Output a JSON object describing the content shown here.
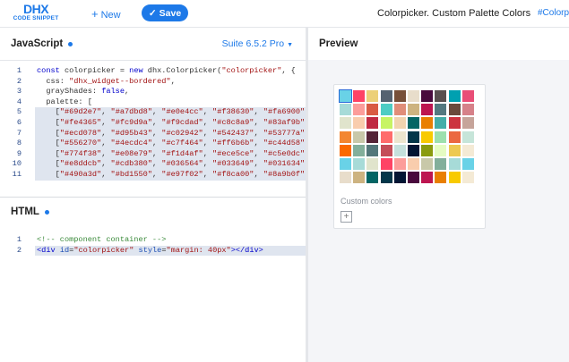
{
  "header": {
    "logo_main": "DHX",
    "logo_sub": "CODE SNIPPET",
    "new_label": "New",
    "save_label": "Save",
    "title": "Colorpicker. Custom Palette Colors",
    "tag": "#Colorp"
  },
  "js_panel": {
    "title": "JavaScript",
    "version": "Suite 6.5.2 Pro"
  },
  "html_panel": {
    "title": "HTML"
  },
  "preview_panel": {
    "title": "Preview",
    "custom_colors_label": "Custom colors"
  },
  "js_lines": [
    {
      "n": "1",
      "html": "<span class=\"kw\">const</span> colorpicker = <span class=\"kw\">new</span> dhx.Colorpicker(<span class=\"str\">\"colorpicker\"</span>, {"
    },
    {
      "n": "2",
      "html": "  css: <span class=\"str\">\"dhx_widget--bordered\"</span>,"
    },
    {
      "n": "3",
      "html": "  grayShades: <span class=\"kw\">false</span>,"
    },
    {
      "n": "4",
      "html": "  palette: ["
    },
    {
      "n": "5",
      "html": "    [<span class=\"str\">\"#69d2e7\"</span>, <span class=\"str\">\"#a7dbd8\"</span>, <span class=\"str\">\"#e0e4cc\"</span>, <span class=\"str\">\"#f38630\"</span>, <span class=\"str\">\"#fa6900\"</span>,"
    },
    {
      "n": "6",
      "html": "    [<span class=\"str\">\"#fe4365\"</span>, <span class=\"str\">\"#fc9d9a\"</span>, <span class=\"str\">\"#f9cdad\"</span>, <span class=\"str\">\"#c8c8a9\"</span>, <span class=\"str\">\"#83af9b\"</span>,"
    },
    {
      "n": "7",
      "html": "    [<span class=\"str\">\"#ecd078\"</span>, <span class=\"str\">\"#d95b43\"</span>, <span class=\"str\">\"#c02942\"</span>, <span class=\"str\">\"#542437\"</span>, <span class=\"str\">\"#53777a\"</span>,"
    },
    {
      "n": "8",
      "html": "    [<span class=\"str\">\"#556270\"</span>, <span class=\"str\">\"#4ecdc4\"</span>, <span class=\"str\">\"#c7f464\"</span>, <span class=\"str\">\"#ff6b6b\"</span>, <span class=\"str\">\"#c44d58\"</span>,"
    },
    {
      "n": "9",
      "html": "    [<span class=\"str\">\"#774f38\"</span>, <span class=\"str\">\"#e08e79\"</span>, <span class=\"str\">\"#f1d4af\"</span>, <span class=\"str\">\"#ece5ce\"</span>, <span class=\"str\">\"#c5e0dc\"</span>,"
    },
    {
      "n": "10",
      "html": "    [<span class=\"str\">\"#e8ddcb\"</span>, <span class=\"str\">\"#cdb380\"</span>, <span class=\"str\">\"#036564\"</span>, <span class=\"str\">\"#033649\"</span>, <span class=\"str\">\"#031634\"</span>,"
    },
    {
      "n": "11",
      "html": "    [<span class=\"str\">\"#490a3d\"</span>, <span class=\"str\">\"#bd1550\"</span>, <span class=\"str\">\"#e97f02\"</span>, <span class=\"str\">\"#f8ca00\"</span>, <span class=\"str\">\"#8a9b0f\"</span>,"
    }
  ],
  "html_lines": [
    {
      "n": "1",
      "html": "<span class=\"cm\">&lt;!-- component container --&gt;</span>"
    },
    {
      "n": "2",
      "html": "<span class=\"kw\">&lt;div</span> <span class=\"at\">id</span>=<span class=\"str\">\"colorpicker\"</span> <span class=\"at\">style</span>=<span class=\"str\">\"margin: 40px\"</span><span class=\"kw\">&gt;&lt;/div&gt;</span>"
    }
  ],
  "palette": [
    "#69d2e7",
    "#fe4365",
    "#ecd078",
    "#556270",
    "#774f38",
    "#e8ddcb",
    "#490a3d",
    "#594f4f",
    "#00a0b0",
    "#e94e77",
    "#a7dbd8",
    "#fc9d9a",
    "#d95b43",
    "#4ecdc4",
    "#e08e79",
    "#cdb380",
    "#bd1550",
    "#547980",
    "#6a4a3c",
    "#d68189",
    "#e0e4cc",
    "#f9cdad",
    "#c02942",
    "#c7f464",
    "#f1d4af",
    "#036564",
    "#e97f02",
    "#45ada8",
    "#cc333f",
    "#c6a49a",
    "#f38630",
    "#c8c8a9",
    "#542437",
    "#ff6b6b",
    "#ece5ce",
    "#033649",
    "#f8ca00",
    "#9de0ad",
    "#eb6841",
    "#c6e5d9",
    "#fa6900",
    "#83af9b",
    "#53777a",
    "#c44d58",
    "#c5e0dc",
    "#031634",
    "#8a9b0f",
    "#e5fcc2",
    "#edc951",
    "#f4ead5",
    "#69d2e7",
    "#a7dbd8",
    "#e0e4cc",
    "#fe4365",
    "#fc9d9a",
    "#f9cdad",
    "#c8c8a9",
    "#83af9b",
    "#a7dbd8",
    "#69d2e7",
    "#e8ddcb",
    "#cdb380",
    "#036564",
    "#033649",
    "#031634",
    "#490a3d",
    "#bd1550",
    "#e97f02",
    "#f8ca00",
    "#f4ead5"
  ],
  "selected_index": 0
}
